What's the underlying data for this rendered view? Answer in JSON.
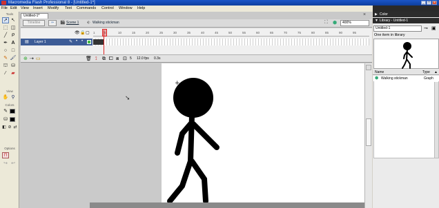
{
  "window": {
    "title": "Macromedia Flash Professional 8 - [Untitled-1*]",
    "min": "_",
    "max": "□",
    "close": "×"
  },
  "menu": [
    "File",
    "Edit",
    "View",
    "Insert",
    "Modify",
    "Text",
    "Commands",
    "Control",
    "Window",
    "Help"
  ],
  "tools_panel": {
    "header": "Tools",
    "view_label": "View",
    "colors_label": "Colors",
    "options_label": "Options"
  },
  "document": {
    "tab": "Untitled-1*",
    "close_glyph": "×"
  },
  "edit_bar": {
    "timeline_button": "Timeline",
    "scene": "Scene 1",
    "symbol": "Walking stickman",
    "zoom": "400%"
  },
  "timeline": {
    "ruler": [
      "1",
      "5",
      "10",
      "15",
      "20",
      "25",
      "30",
      "35",
      "40",
      "45",
      "50",
      "55",
      "60",
      "65",
      "70",
      "75",
      "80",
      "85",
      "90",
      "95"
    ],
    "layer_name": "Layer 1",
    "current_frame": "5",
    "fps": "12.0 fps",
    "elapsed": "0.3s"
  },
  "library": {
    "color_header": "Color",
    "header": "Library - Untitled-1",
    "select_value": "Untitled-1",
    "count_text": "One item in library",
    "col_name": "Name",
    "col_type": "Type",
    "items": [
      {
        "name": "Walking stickman",
        "type": "Graph"
      }
    ]
  },
  "colors": {
    "panel_header": "#2c2c2c",
    "layer_selected": "#3c5b96",
    "playhead": "#d22222",
    "titlebar": "#1a55c8"
  }
}
